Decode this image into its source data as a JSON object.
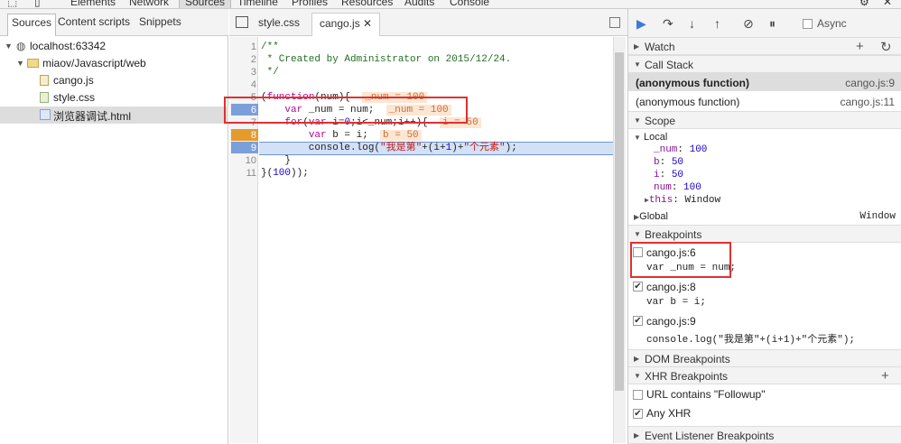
{
  "top_tabs": [
    "Elements",
    "Network",
    "Sources",
    "Timeline",
    "Profiles",
    "Resources",
    "Audits",
    "Console"
  ],
  "navigator": {
    "tabs": [
      "Sources",
      "Content scripts",
      "Snippets"
    ],
    "tree": {
      "origin": "localhost:63342",
      "folder": "miaov/Javascript/web",
      "files": [
        "cango.js",
        "style.css",
        "浏览器调试.html"
      ]
    }
  },
  "editor": {
    "tabs": [
      "style.css",
      "cango.js"
    ],
    "active_tab": "cango.js",
    "line_numbers": [
      "1",
      "2",
      "3",
      "4",
      "5",
      "6",
      "7",
      "8",
      "9",
      "10",
      "11"
    ],
    "inline_values": {
      "l5": "_num = 100",
      "l6": "_num = 100",
      "l7": "i = 50",
      "l8": "b = 50"
    },
    "breakpoint_lines": [
      "6",
      "8",
      "9"
    ]
  },
  "debugger": {
    "async_label": "Async",
    "sections": {
      "watch": "Watch",
      "call_stack": "Call Stack",
      "scope": "Scope",
      "breakpoints": "Breakpoints",
      "dom_breakpoints": "DOM Breakpoints",
      "xhr_breakpoints": "XHR Breakpoints",
      "event_listener_breakpoints": "Event Listener Breakpoints"
    },
    "call_stack": [
      {
        "fn": "(anonymous function)",
        "loc": "cango.js:9"
      },
      {
        "fn": "(anonymous function)",
        "loc": "cango.js:11"
      }
    ],
    "scope": {
      "local_label": "Local",
      "vars": [
        {
          "name": "_num",
          "value": "100"
        },
        {
          "name": "b",
          "value": "50"
        },
        {
          "name": "i",
          "value": "50"
        },
        {
          "name": "num",
          "value": "100"
        }
      ],
      "this_name": "this",
      "this_value": "Window",
      "global_label": "Global",
      "global_value": "Window"
    },
    "breakpoints": [
      {
        "file": "cango.js:6",
        "code": "var _num = num;",
        "checked": false
      },
      {
        "file": "cango.js:8",
        "code": "var b = i;",
        "checked": true
      },
      {
        "file": "cango.js:9",
        "code": "console.log(\"我是第\"+(i+1)+\"个元素\");",
        "checked": true
      }
    ],
    "xhr": [
      {
        "label": "URL contains \"Followup\"",
        "checked": false
      },
      {
        "label": "Any XHR",
        "checked": true
      }
    ]
  }
}
